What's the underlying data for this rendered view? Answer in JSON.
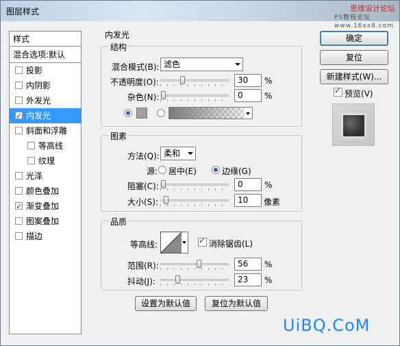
{
  "window": {
    "title": "图层样式"
  },
  "watermark_top": {
    "text": "思缘设计论坛",
    "sub": "PS教程论坛",
    "url": "www.16xx8.com"
  },
  "left_panel": {
    "header": "样式",
    "blend_options": "混合选项:默认",
    "items": [
      {
        "label": "投影",
        "checked": false,
        "selected": false,
        "indent": false
      },
      {
        "label": "内阴影",
        "checked": false,
        "selected": false,
        "indent": false
      },
      {
        "label": "外发光",
        "checked": false,
        "selected": false,
        "indent": false
      },
      {
        "label": "内发光",
        "checked": true,
        "selected": true,
        "indent": false
      },
      {
        "label": "斜面和浮雕",
        "checked": false,
        "selected": false,
        "indent": false
      },
      {
        "label": "等高线",
        "checked": false,
        "selected": false,
        "indent": true
      },
      {
        "label": "纹理",
        "checked": false,
        "selected": false,
        "indent": true
      },
      {
        "label": "光泽",
        "checked": false,
        "selected": false,
        "indent": false
      },
      {
        "label": "颜色叠加",
        "checked": false,
        "selected": false,
        "indent": false
      },
      {
        "label": "渐变叠加",
        "checked": true,
        "selected": false,
        "indent": false
      },
      {
        "label": "图案叠加",
        "checked": false,
        "selected": false,
        "indent": false
      },
      {
        "label": "描边",
        "checked": false,
        "selected": false,
        "indent": false
      }
    ]
  },
  "inner_glow": {
    "title": "内发光",
    "structure": {
      "title": "结构",
      "blend_mode_label": "混合模式(B):",
      "blend_mode_value": "滤色",
      "opacity_label": "不透明度(O):",
      "opacity_value": "30",
      "opacity_unit": "%",
      "opacity_fraction": 0.3,
      "noise_label": "杂色(N):",
      "noise_value": "0",
      "noise_unit": "%",
      "noise_fraction": 0.0
    },
    "elements": {
      "title": "图素",
      "technique_label": "方法(Q):",
      "technique_value": "柔和",
      "source_label": "源:",
      "source_center": "居中(E)",
      "source_edge": "边缘(G)",
      "choke_label": "阻塞(C):",
      "choke_value": "0",
      "choke_unit": "%",
      "choke_fraction": 0.0,
      "size_label": "大小(S):",
      "size_value": "10",
      "size_unit": "像素",
      "size_fraction": 0.04
    },
    "quality": {
      "title": "品质",
      "contour_label": "等高线:",
      "antialias_label": "消除锯齿(L)",
      "antialias_checked": true,
      "range_label": "范围(R):",
      "range_value": "56",
      "range_unit": "%",
      "range_fraction": 0.56,
      "jitter_label": "抖动(J):",
      "jitter_value": "23",
      "jitter_unit": "%",
      "jitter_fraction": 0.23
    },
    "buttons": {
      "make_default": "设置为默认值",
      "reset_default": "复位为默认值"
    }
  },
  "right_buttons": {
    "ok": "确定",
    "reset": "复位",
    "new_style": "新建样式(W)...",
    "preview_label": "预览(V)",
    "preview_checked": true
  },
  "footer_watermark": "UiBQ.CoM",
  "colors": {
    "selection": "#3399ff",
    "watermark": "#1f86ff",
    "glow_swatch": "#a0a0a0"
  }
}
